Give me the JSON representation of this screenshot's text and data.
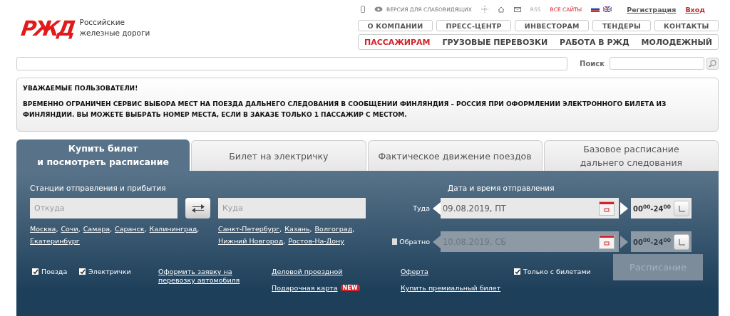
{
  "logo": {
    "mark": "РЖД",
    "line1": "Российские",
    "line2": "железные дороги"
  },
  "utility": {
    "accessibility": "ВЕРСИЯ ДЛЯ СЛАБОВИДЯЩИХ",
    "rss": "RSS",
    "all_sites": "ВСЕ САЙТЫ",
    "register": "Регистрация",
    "login": "Вход"
  },
  "secondary_nav": [
    "О КОМПАНИИ",
    "ПРЕСС-ЦЕНТР",
    "ИНВЕСТОРАМ",
    "ТЕНДЕРЫ",
    "КОНТАКТЫ"
  ],
  "main_nav": [
    {
      "label": "ПАССАЖИРАМ",
      "selected": true
    },
    {
      "label": "ГРУЗОВЫЕ ПЕРЕВОЗКИ",
      "selected": false
    },
    {
      "label": "РАБОТА В РЖД",
      "selected": false
    },
    {
      "label": "МОЛОДЕЖНЫЙ",
      "selected": false
    }
  ],
  "search": {
    "label": "Поиск"
  },
  "notice": {
    "title": "УВАЖАЕМЫЕ ПОЛЬЗОВАТЕЛИ!",
    "text": "ВРЕМЕННО ОГРАНИЧЕН СЕРВИС ВЫБОРА МЕСТ НА ПОЕЗДА ДАЛЬНЕГО СЛЕДОВАНИЯ В СООБЩЕНИИ ФИНЛЯНДИЯ – РОССИЯ ПРИ ОФОРМЛЕНИИ ЭЛЕКТРОННОГО БИЛЕТА ИЗ ФИНЛЯНДИИ. ВЫ МОЖЕТЕ ВЫБРАТЬ НОМЕР МЕСТА, ЕСЛИ В ЗАКАЗЕ ТОЛЬКО 1 ПАССАЖИР С МЕСТОМ."
  },
  "tabs": [
    {
      "label": "Купить билет\nи посмотреть расписание",
      "selected": true
    },
    {
      "label": "Билет на электричку",
      "selected": false
    },
    {
      "label": "Фактическое движение поездов",
      "selected": false
    },
    {
      "label": "Базовое расписание\nдальнего следования",
      "selected": false
    }
  ],
  "form": {
    "stations_label": "Станции отправления и прибытия",
    "from": {
      "placeholder": "Откуда"
    },
    "to": {
      "placeholder": "Куда"
    },
    "separator": ",",
    "from_suggestions": [
      "Москва",
      "Сочи",
      "Самара",
      "Саранск",
      "Калининград",
      "Екатеринбург"
    ],
    "to_suggestions": [
      "Санкт-Петербург",
      "Казань",
      "Волгоград",
      "Нижний Новгород",
      "Ростов-На-Дону"
    ],
    "date_label": "Дата и время отправления",
    "trips": [
      {
        "label": "Туда",
        "date": "09.08.2019, ПТ",
        "time": "00$^{00}$-24$^{00}$",
        "disabled": false
      },
      {
        "label": "Обратно",
        "date": "10.08.2019, СБ",
        "time": "00$^{00}$-24$^{00}$",
        "disabled": true,
        "checked": false
      }
    ],
    "filters": [
      {
        "label": "Поезда",
        "checked": true
      },
      {
        "label": "Электрички",
        "checked": true
      }
    ],
    "car_link": "Оформить заявку на перевозку автомобиля",
    "business_link": "Деловой проездной",
    "gift_link": "Подарочная карта",
    "gift_badge": "NEW",
    "offer_link": "Оферта",
    "premium_link": "Купить премиальный билет",
    "only_with_tickets": {
      "label": "Только с билетами",
      "checked": true
    },
    "submit": {
      "label": "Расписание",
      "disabled": true
    }
  }
}
